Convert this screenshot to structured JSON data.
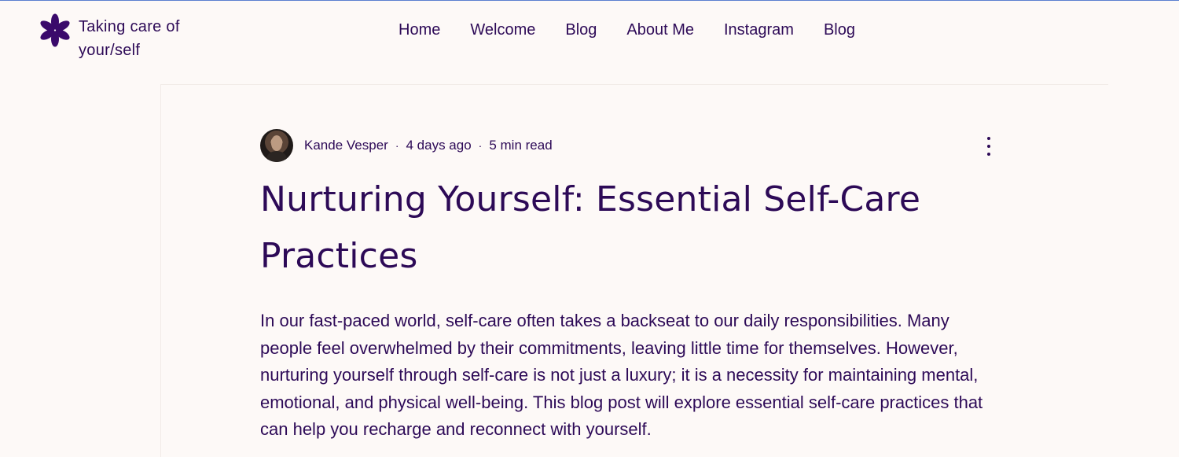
{
  "site": {
    "title": "Taking care of your/self",
    "logo_icon": "asterisk-flower-icon"
  },
  "nav": {
    "items": [
      "Home",
      "Welcome",
      "Blog",
      "About Me",
      "Instagram",
      "Blog"
    ]
  },
  "post": {
    "author": "Kande Vesper",
    "date": "4 days ago",
    "read_time": "5 min read",
    "separator": "·",
    "title": "Nurturing Yourself: Essential Self-Care Practices",
    "body": "In our fast-paced world, self-care often takes a backseat to our daily responsibilities. Many people feel overwhelmed by their commitments, leaving little time for themselves. However, nurturing yourself through self-care is not just a luxury; it is a necessity for maintaining mental, emotional, and physical well-being. This blog post will explore essential self-care practices that can help you recharge and reconnect with yourself."
  },
  "colors": {
    "brand": "#2d0a57",
    "background": "#fdf9f7"
  }
}
